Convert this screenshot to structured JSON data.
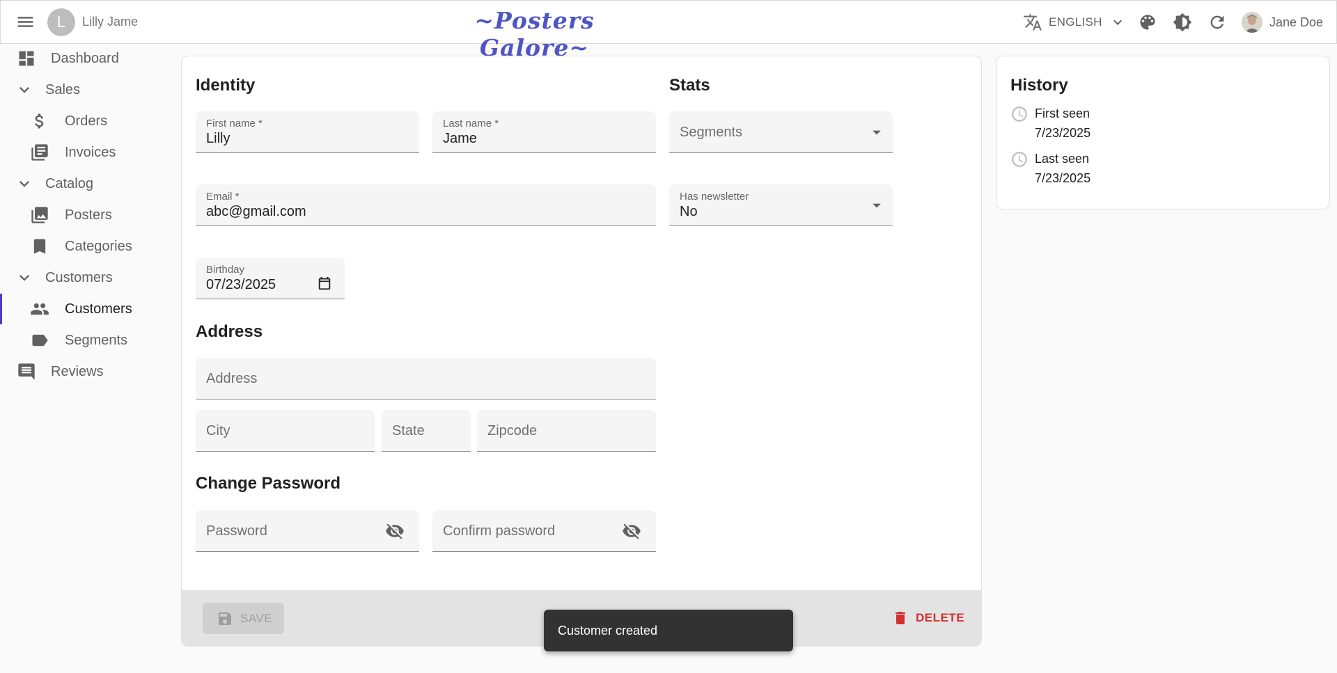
{
  "appbar": {
    "breadcrumb_initial": "L",
    "breadcrumb_name": "Lilly Jame",
    "title": "~Posters Galore~",
    "language": "ENGLISH",
    "user_name": "Jane Doe",
    "icons": [
      "menu-icon",
      "translate-icon",
      "chevron-down-icon",
      "palette-icon",
      "theme-toggle-icon",
      "refresh-icon"
    ]
  },
  "sidebar": {
    "dashboard": "Dashboard",
    "sales": "Sales",
    "orders": "Orders",
    "invoices": "Invoices",
    "catalog": "Catalog",
    "posters": "Posters",
    "categories": "Categories",
    "customers_group": "Customers",
    "customers": "Customers",
    "segments": "Segments",
    "reviews": "Reviews",
    "active_item": "Customers",
    "accent_color": "#4f3cc9"
  },
  "form": {
    "identity_title": "Identity",
    "stats_title": "Stats",
    "first_name": {
      "label": "First name *",
      "value": "Lilly"
    },
    "last_name": {
      "label": "Last name *",
      "value": "Jame"
    },
    "segments": {
      "placeholder": "Segments"
    },
    "email": {
      "label": "Email *",
      "value": "abc@gmail.com"
    },
    "has_newsletter": {
      "label": "Has newsletter",
      "value": "No"
    },
    "birthday": {
      "label": "Birthday",
      "value": "07/23/2025"
    },
    "address_title": "Address",
    "address": {
      "placeholder": "Address"
    },
    "city": {
      "placeholder": "City"
    },
    "state": {
      "placeholder": "State"
    },
    "zipcode": {
      "placeholder": "Zipcode"
    },
    "password_title": "Change Password",
    "password": {
      "placeholder": "Password"
    },
    "confirm_password": {
      "placeholder": "Confirm password"
    }
  },
  "toolbar": {
    "save_label": "SAVE",
    "delete_label": "DELETE",
    "delete_color": "#d32f2f"
  },
  "history": {
    "title": "History",
    "first_seen_label": "First seen",
    "first_seen_date": "7/23/2025",
    "last_seen_label": "Last seen",
    "last_seen_date": "7/23/2025"
  },
  "snackbar": {
    "message": "Customer created"
  }
}
